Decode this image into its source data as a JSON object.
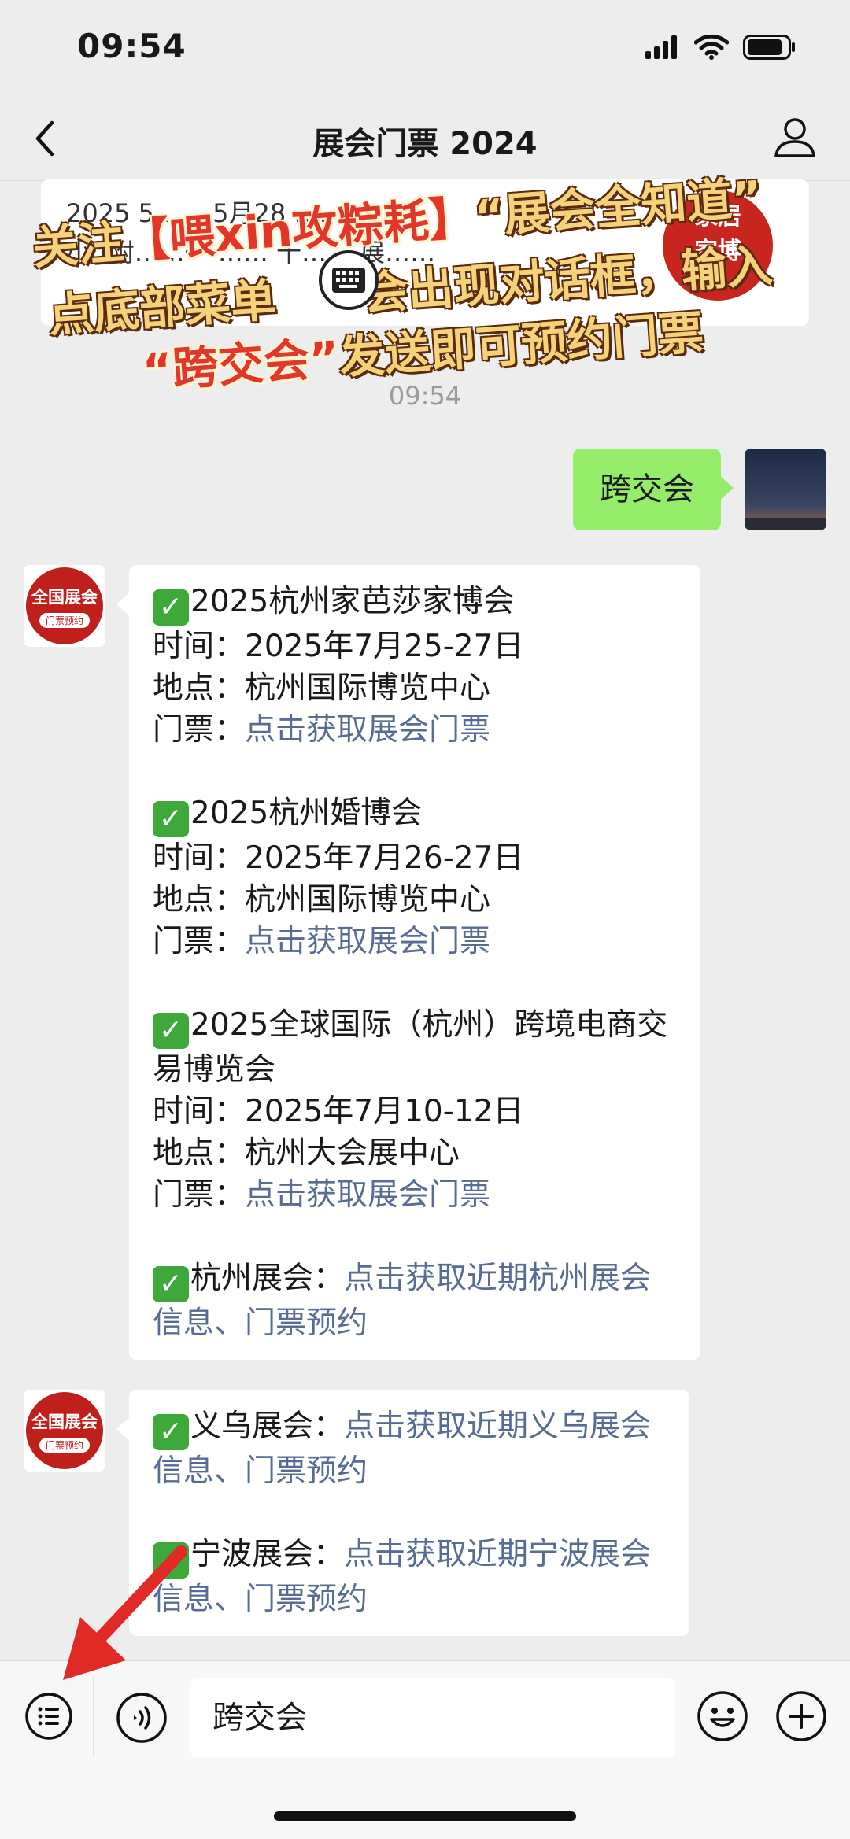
{
  "status": {
    "time": "09:54"
  },
  "nav": {
    "title": "展会门票 2024"
  },
  "top_card": {
    "line1": "2025 5 ……5月28 ……",
    "line2": "小 (附……一 …… 十…… 展……",
    "thumb_line1": "家居",
    "thumb_line2": "家博"
  },
  "overlay": {
    "line1_a": "关注",
    "line1_b": "【喂xin攻粽耗】",
    "line1_c": "“展会全知道”",
    "line2_a": "点底部菜单",
    "line2_b": "会出现对话框，输入",
    "line3_a": "“跨交会”",
    "line3_b": "发送即可预约门票"
  },
  "timestamp": "09:54",
  "sent_message": "跨交会",
  "bot_avatar": {
    "title": "全国展会",
    "subtitle": "门票预约"
  },
  "message1": {
    "events": [
      {
        "name": "2025杭州家芭莎家博会",
        "time_label": "时间：",
        "time": "2025年7月25-27日",
        "place_label": "地点：",
        "place": "杭州国际博览中心",
        "ticket_label": "门票：",
        "ticket_link": "点击获取展会门票"
      },
      {
        "name": "2025杭州婚博会",
        "time_label": "时间：",
        "time": "2025年7月26-27日",
        "place_label": "地点：",
        "place": "杭州国际博览中心",
        "ticket_label": "门票：",
        "ticket_link": "点击获取展会门票"
      },
      {
        "name": "2025全球国际（杭州）跨境电商交易博览会",
        "time_label": "时间：",
        "time": "2025年7月10-12日",
        "place_label": "地点：",
        "place": "杭州大会展中心",
        "ticket_label": "门票：",
        "ticket_link": "点击获取展会门票"
      }
    ],
    "city_label": "杭州展会：",
    "city_link": "点击获取近期杭州展会信息、门票预约"
  },
  "message2": {
    "items": [
      {
        "label": "义乌展会：",
        "link": "点击获取近期义乌展会信息、门票预约"
      },
      {
        "label": "宁波展会：",
        "link": "点击获取近期宁波展会信息、门票预约"
      }
    ]
  },
  "input": {
    "value": "跨交会"
  },
  "colors": {
    "sent_bubble": "#95ec69",
    "link": "#576b95",
    "check": "#3ea83a",
    "background": "#ededed"
  }
}
